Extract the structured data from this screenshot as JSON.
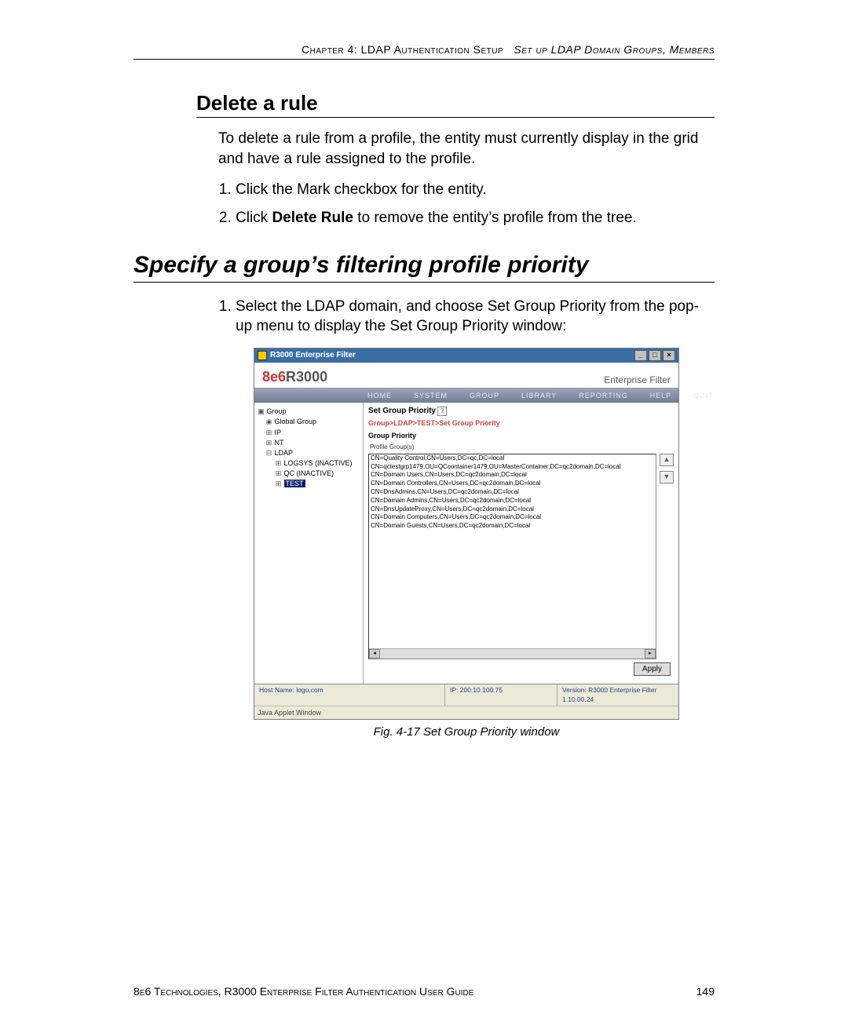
{
  "header": {
    "left": "Chapter 4: LDAP Authentication Setup",
    "right": "Set up LDAP Domain Groups, Members"
  },
  "h3": "Delete a rule",
  "intro": "To delete a rule from a profile, the entity must currently display in the grid and have a rule assigned to the profile.",
  "step1": "Click the Mark checkbox for the entity.",
  "step2_pre": "Click ",
  "step2_bold": "Delete Rule",
  "step2_post": " to remove the entity’s profile from the tree.",
  "h2": "Specify a group’s filtering profile priority",
  "sec_step1": "Select the LDAP domain, and choose Set Group Priority from the pop-up menu to display the Set Group Priority window:",
  "caption": "Fig. 4-17  Set Group Priority window",
  "footer_left": "8e6 Technologies, R3000 Enterprise Filter Authentication User Guide",
  "footer_right": "149",
  "app": {
    "title": "R3000 Enterprise Filter",
    "brand_left_red": "8e6",
    "brand_left_rest": "R3000",
    "brand_right": "Enterprise Filter",
    "menu": [
      "HOME",
      "SYSTEM",
      "GROUP",
      "LIBRARY",
      "REPORTING",
      "HELP",
      "QUIT"
    ],
    "tree": {
      "root": "Group",
      "global": "Global Group",
      "ip": "IP",
      "nt": "NT",
      "ldap": "LDAP",
      "n1": "LOGSYS (INACTIVE)",
      "n2": "QC (INACTIVE)",
      "n3": "TEST"
    },
    "panel_title": "Set Group Priority",
    "breadcrumb": "Group>LDAP>TEST>Set Group Priority",
    "group_priority_label": "Group Priority",
    "profile_groups_label": "Profile Group(s)",
    "list": [
      "CN=Quality Control,CN=Users,DC=qc,DC=local",
      "CN=qctestgrp1479,OU=QCcontainer1479,OU=MasterContainer,DC=qc2domain,DC=local",
      "CN=Domain Users,CN=Users,DC=qc2domain,DC=local",
      "CN=Domain Controllers,CN=Users,DC=qc2domain,DC=local",
      "CN=DnsAdmins,CN=Users,DC=qc2domain,DC=local",
      "CN=Domain Admins,CN=Users,DC=qc2domain,DC=local",
      "CN=DnsUpdateProxy,CN=Users,DC=qc2domain,DC=local",
      "CN=Domain Computers,CN=Users,DC=qc2domain,DC=local",
      "CN=Domain Guests,CN=Users,DC=qc2domain,DC=local"
    ],
    "apply": "Apply",
    "status_host": "Host Name: logo.com",
    "status_ip": "IP: 200.10.100.75",
    "status_ver": "Version: R3000 Enterprise Filter 1.10.00.24",
    "applet": "Java Applet Window"
  }
}
